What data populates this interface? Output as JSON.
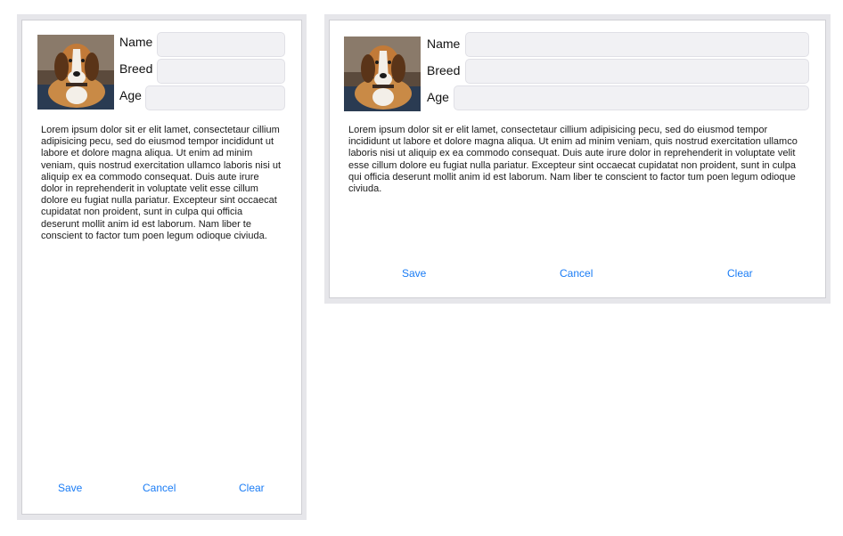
{
  "form": {
    "labels": {
      "name": "Name",
      "breed": "Breed",
      "age": "Age"
    },
    "values": {
      "name": "",
      "breed": "",
      "age": ""
    },
    "photo_icon": "beagle-dog-photo"
  },
  "description": "Lorem ipsum dolor sit er elit lamet, consectetaur cillium adipisicing pecu, sed do eiusmod tempor incididunt ut labore et dolore magna aliqua. Ut enim ad minim veniam, quis nostrud exercitation ullamco laboris nisi ut aliquip ex ea commodo consequat. Duis aute irure dolor in reprehenderit in voluptate velit esse cillum dolore eu fugiat nulla pariatur. Excepteur sint occaecat cupidatat non proident, sunt in culpa qui officia deserunt mollit anim id est laborum. Nam liber te conscient to factor tum poen legum odioque civiuda.",
  "buttons": {
    "save": "Save",
    "cancel": "Cancel",
    "clear": "Clear"
  },
  "colors": {
    "accent": "#1a7cf5",
    "field_bg": "#f1f1f4",
    "device_bezel": "#e6e6ea"
  }
}
